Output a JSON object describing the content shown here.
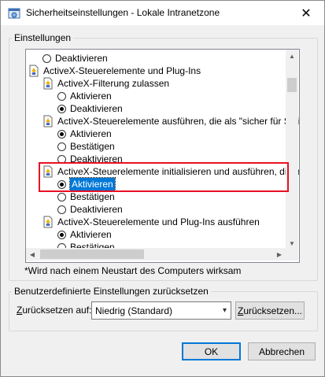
{
  "window": {
    "title": "Sicherheitseinstellungen - Lokale Intranetzone",
    "close_glyph": "✕"
  },
  "settings_group": {
    "label": "Einstellungen",
    "items": [
      {
        "kind": "radio",
        "checked": false,
        "label": "Deaktivieren"
      },
      {
        "kind": "section",
        "label": "ActiveX-Steuerelemente und Plug-Ins"
      },
      {
        "kind": "setting",
        "label": "ActiveX-Filterung zulassen"
      },
      {
        "kind": "radio",
        "checked": false,
        "label": "Aktivieren"
      },
      {
        "kind": "radio",
        "checked": true,
        "label": "Deaktivieren"
      },
      {
        "kind": "setting",
        "label": "ActiveX-Steuerelemente ausführen, die als \"sicher für Skriptin"
      },
      {
        "kind": "radio",
        "checked": true,
        "label": "Aktivieren"
      },
      {
        "kind": "radio",
        "checked": false,
        "label": "Bestätigen"
      },
      {
        "kind": "radio",
        "checked": false,
        "label": "Deaktivieren"
      },
      {
        "kind": "setting",
        "label": "ActiveX-Steuerelemente initialisieren und ausführen, die nich"
      },
      {
        "kind": "radio",
        "checked": true,
        "label": "Aktivieren",
        "selected": true
      },
      {
        "kind": "radio",
        "checked": false,
        "label": "Bestätigen"
      },
      {
        "kind": "radio",
        "checked": false,
        "label": "Deaktivieren"
      },
      {
        "kind": "setting",
        "label": "ActiveX-Steuerelemente und Plug-Ins ausführen"
      },
      {
        "kind": "radio",
        "checked": true,
        "label": "Aktivieren"
      },
      {
        "kind": "radio",
        "checked": false,
        "label": "Bestätigen"
      }
    ],
    "note": "*Wird nach einem Neustart des Computers wirksam"
  },
  "reset_group": {
    "label": "Benutzerdefinierte Einstellungen zurücksetzen",
    "reset_to_prefix": "Z",
    "reset_to_rest": "urücksetzen auf:",
    "level_value": "Niedrig (Standard)",
    "reset_button_prefix": "Z",
    "reset_button_rest": "urücksetzen..."
  },
  "buttons": {
    "ok": "OK",
    "cancel": "Abbrechen"
  },
  "colors": {
    "highlight_border": "#e81123",
    "selection": "#0078d7"
  }
}
